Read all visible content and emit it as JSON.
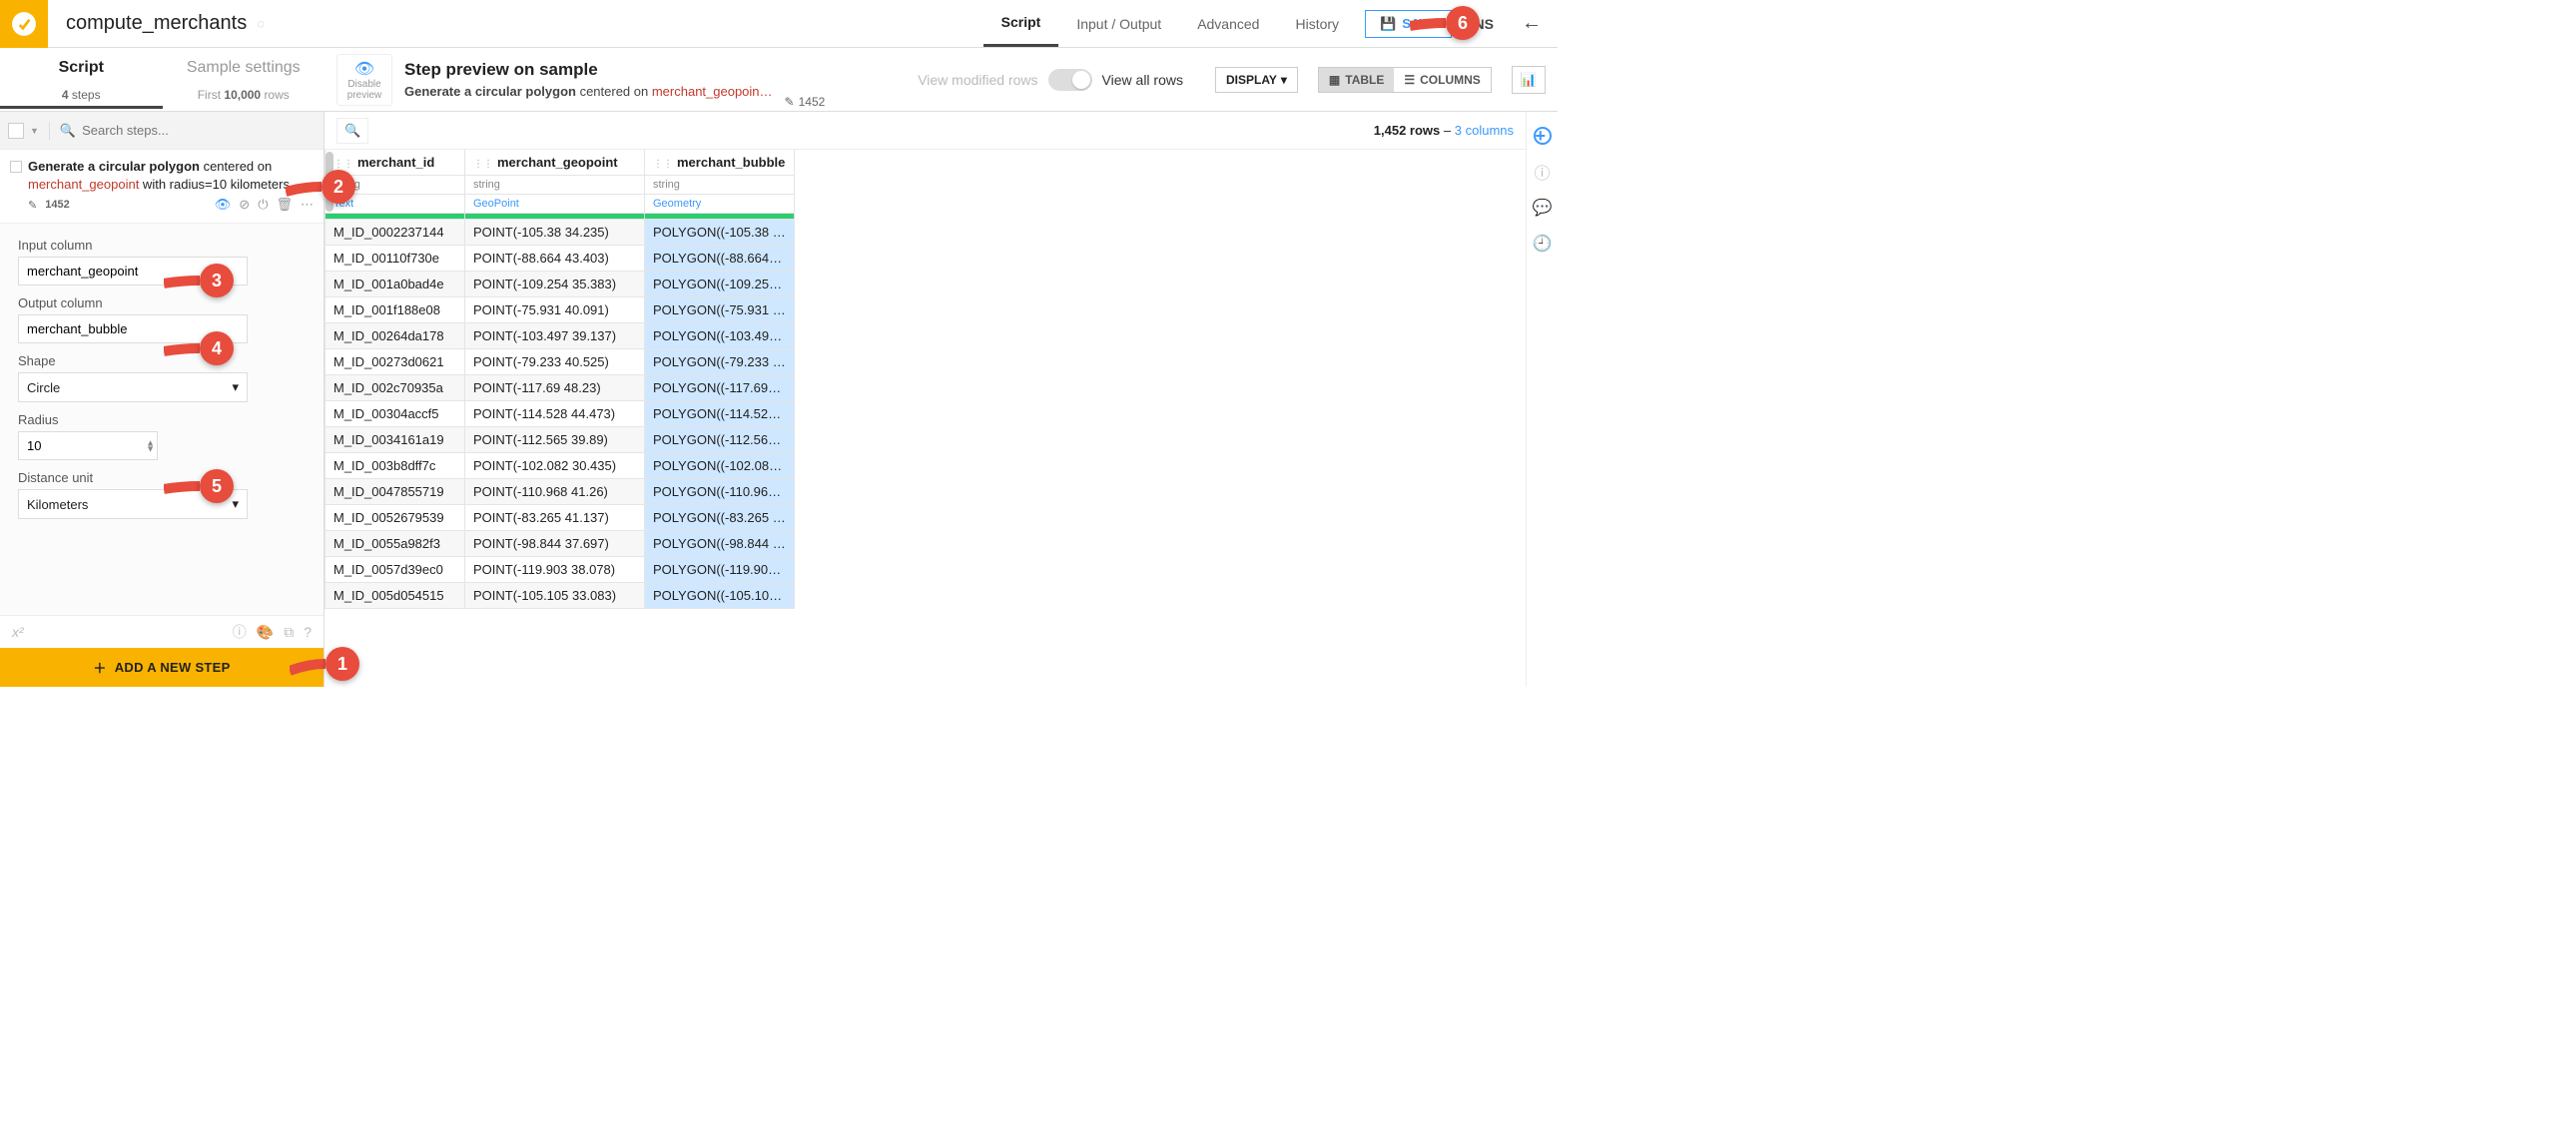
{
  "header": {
    "title": "compute_merchants",
    "nav": [
      "Script",
      "Input / Output",
      "Advanced",
      "History"
    ],
    "active_nav": "Script",
    "save": "SAVE",
    "actions": "ONS"
  },
  "left_tabs": {
    "tab1": "Script",
    "tab2": "Sample settings",
    "sub1_prefix": "4",
    "sub1_suffix": "steps",
    "sub2_prefix": "First",
    "sub2_mid": "10,000",
    "sub2_suffix": "rows"
  },
  "preview": {
    "disable": "Disable preview",
    "title": "Step preview on sample",
    "desc_bold": "Generate a circular polygon",
    "desc_mid": " centered on ",
    "desc_red": "merchant_geopoin…",
    "modified": "View modified rows",
    "allrows": "View all rows",
    "count": "1452",
    "display": "DISPLAY",
    "table": "TABLE",
    "columns": "COLUMNS"
  },
  "search": {
    "placeholder": "Search steps..."
  },
  "step": {
    "line1_bold": "Generate a circular polygon",
    "line1_rest": " centered on ",
    "line2_red": "merchant_geopoint",
    "line2_rest": " with radius=10 kilometers",
    "count": "1452"
  },
  "form": {
    "input_col_label": "Input column",
    "input_col_value": "merchant_geopoint",
    "output_col_label": "Output column",
    "output_col_value": "merchant_bubble",
    "shape_label": "Shape",
    "shape_value": "Circle",
    "radius_label": "Radius",
    "radius_value": "10",
    "unit_label": "Distance unit",
    "unit_value": "Kilometers"
  },
  "add_step": "ADD A NEW STEP",
  "table": {
    "rows_label": "1,452 rows",
    "cols_label": "3 columns",
    "headers": [
      "merchant_id",
      "merchant_geopoint",
      "merchant_bubble"
    ],
    "types": [
      "string",
      "string",
      "string"
    ],
    "semantics": [
      "Text",
      "GeoPoint",
      "Geometry"
    ],
    "rows": [
      [
        "M_ID_0002237144",
        "POINT(-105.38 34.235)",
        "POLYGON((-105.38 …"
      ],
      [
        "M_ID_00110f730e",
        "POINT(-88.664 43.403)",
        "POLYGON((-88.664…"
      ],
      [
        "M_ID_001a0bad4e",
        "POINT(-109.254 35.383)",
        "POLYGON((-109.25…"
      ],
      [
        "M_ID_001f188e08",
        "POINT(-75.931 40.091)",
        "POLYGON((-75.931 …"
      ],
      [
        "M_ID_00264da178",
        "POINT(-103.497 39.137)",
        "POLYGON((-103.49…"
      ],
      [
        "M_ID_00273d0621",
        "POINT(-79.233 40.525)",
        "POLYGON((-79.233 …"
      ],
      [
        "M_ID_002c70935a",
        "POINT(-117.69 48.23)",
        "POLYGON((-117.69…"
      ],
      [
        "M_ID_00304accf5",
        "POINT(-114.528 44.473)",
        "POLYGON((-114.52…"
      ],
      [
        "M_ID_0034161a19",
        "POINT(-112.565 39.89)",
        "POLYGON((-112.56…"
      ],
      [
        "M_ID_003b8dff7c",
        "POINT(-102.082 30.435)",
        "POLYGON((-102.08…"
      ],
      [
        "M_ID_0047855719",
        "POINT(-110.968 41.26)",
        "POLYGON((-110.96…"
      ],
      [
        "M_ID_0052679539",
        "POINT(-83.265 41.137)",
        "POLYGON((-83.265 …"
      ],
      [
        "M_ID_0055a982f3",
        "POINT(-98.844 37.697)",
        "POLYGON((-98.844 …"
      ],
      [
        "M_ID_0057d39ec0",
        "POINT(-119.903 38.078)",
        "POLYGON((-119.90…"
      ],
      [
        "M_ID_005d054515",
        "POINT(-105.105 33.083)",
        "POLYGON((-105.10…"
      ]
    ]
  },
  "callouts": {
    "1": "1",
    "2": "2",
    "3": "3",
    "4": "4",
    "5": "5",
    "6": "6"
  }
}
